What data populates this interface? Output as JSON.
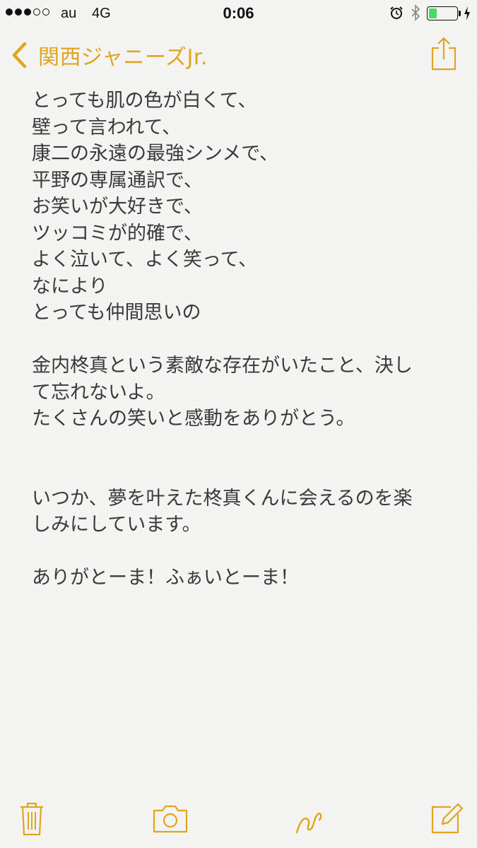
{
  "status_bar": {
    "carrier": "au",
    "network": "4G",
    "time": "0:06",
    "signal_bars_filled": 3,
    "signal_bars_total": 5,
    "battery_level_fraction": 0.3,
    "icons": [
      "alarm-icon",
      "bluetooth-icon",
      "battery-icon",
      "charging-icon"
    ]
  },
  "nav": {
    "back_label": "関西ジャニーズJr.",
    "back_icon": "chevron-left-icon",
    "share_icon": "share-icon"
  },
  "note": {
    "lines": [
      "とっても肌の色が白くて、",
      "壁って言われて、",
      "康二の永遠の最強シンメで、",
      "平野の専属通訳で、",
      "お笑いが大好きで、",
      "ツッコミが的確で、",
      "よく泣いて、よく笑って、",
      "なにより",
      "とっても仲間思いの",
      "",
      "金内柊真という素敵な存在がいたこと、決し",
      "て忘れないよ。",
      "たくさんの笑いと感動をありがとう。",
      "",
      "",
      "いつか、夢を叶えた柊真くんに会えるのを楽",
      "しみにしています。",
      "",
      "ありがとーま！ふぁいとーま！"
    ]
  },
  "toolbar": {
    "items": [
      "trash-icon",
      "camera-icon",
      "sketch-icon",
      "compose-icon"
    ]
  },
  "colors": {
    "accent": "#e0a51e",
    "text": "#3a3a3a",
    "background": "#f5f5f3"
  }
}
